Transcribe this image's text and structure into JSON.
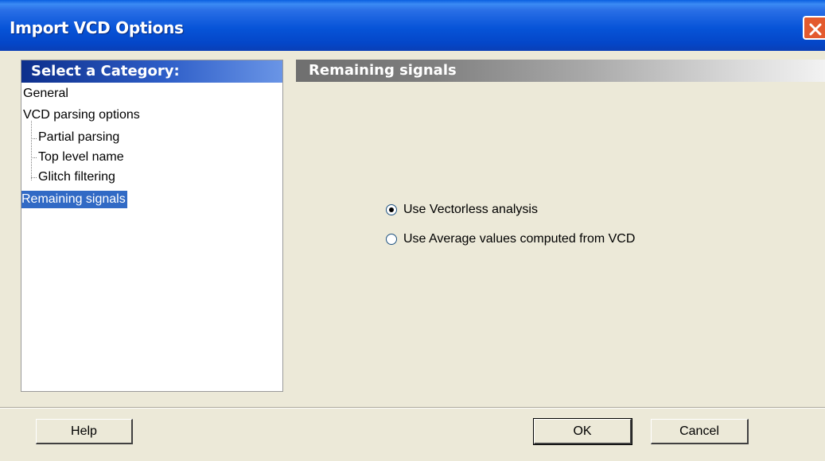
{
  "window": {
    "title": "Import VCD Options"
  },
  "categories": {
    "header": "Select a Category:",
    "items": [
      {
        "label": "General",
        "level": 0,
        "selected": false
      },
      {
        "label": "VCD parsing options",
        "level": 0,
        "selected": false
      },
      {
        "label": "Partial parsing",
        "level": 1,
        "selected": false
      },
      {
        "label": "Top level name",
        "level": 1,
        "selected": false
      },
      {
        "label": "Glitch filtering",
        "level": 1,
        "selected": false
      },
      {
        "label": "Remaining signals",
        "level": 0,
        "selected": true
      }
    ]
  },
  "panel": {
    "header": "Remaining signals",
    "options": [
      {
        "label": "Use Vectorless analysis",
        "checked": true
      },
      {
        "label": "Use Average values computed from VCD",
        "checked": false
      }
    ]
  },
  "buttons": {
    "help": "Help",
    "ok": "OK",
    "cancel": "Cancel"
  },
  "colors": {
    "titlebar": "#0754d8",
    "selection": "#316ac5",
    "dialog_bg": "#ece9d8",
    "close": "#e35a2e"
  }
}
